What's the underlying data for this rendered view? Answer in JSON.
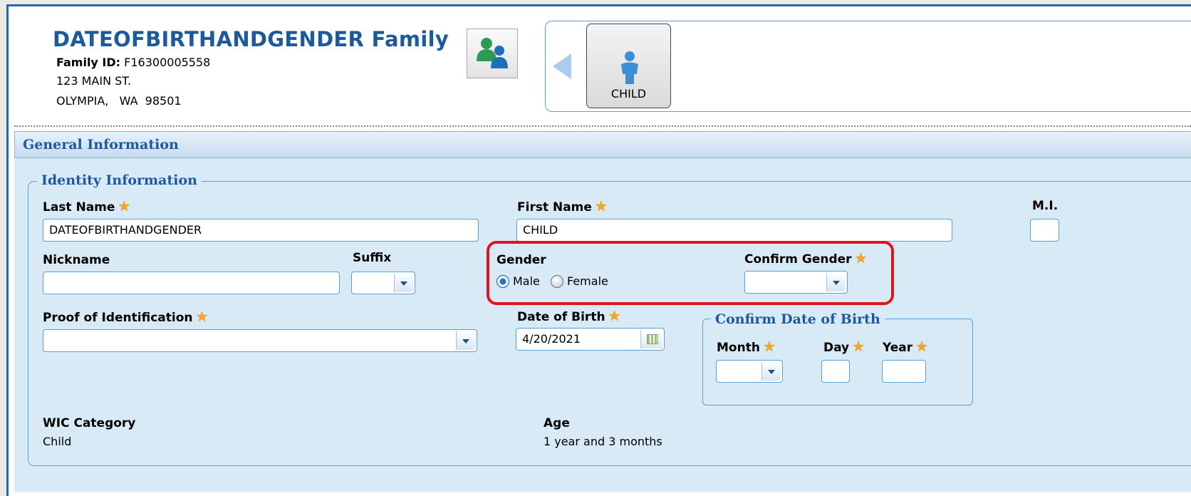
{
  "family": {
    "title": "DATEOFBIRTHANDGENDER Family",
    "id_label": "Family ID:",
    "id_value": "F16300005558",
    "address_line1": "123 MAIN ST.",
    "address_line2": "OLYMPIA,   WA  98501"
  },
  "members": [
    {
      "label": "CHILD",
      "icon": "child-person-icon",
      "selected": true
    }
  ],
  "section": {
    "title": "General Information"
  },
  "identity": {
    "legend": "Identity Information",
    "last_name": {
      "label": "Last Name",
      "value": "DATEOFBIRTHANDGENDER",
      "required": true
    },
    "first_name": {
      "label": "First Name",
      "value": "CHILD",
      "required": true
    },
    "mi": {
      "label": "M.I.",
      "value": ""
    },
    "nickname": {
      "label": "Nickname",
      "value": ""
    },
    "suffix": {
      "label": "Suffix",
      "value": ""
    },
    "gender": {
      "label": "Gender",
      "options": [
        "Male",
        "Female"
      ],
      "selected": "Male"
    },
    "confirm_gender": {
      "label": "Confirm Gender",
      "value": "",
      "required": true
    },
    "proof_of_id": {
      "label": "Proof of Identification",
      "value": "",
      "required": true
    },
    "dob": {
      "label": "Date of Birth",
      "value": "4/20/2021",
      "required": true
    },
    "confirm_dob": {
      "legend": "Confirm Date of Birth",
      "month_label": "Month",
      "day_label": "Day",
      "year_label": "Year"
    },
    "wic_category": {
      "label": "WIC Category",
      "value": "Child"
    },
    "age": {
      "label": "Age",
      "value": "1 year and 3 months"
    }
  },
  "colors": {
    "accent": "#1d5a9c",
    "panel": "#d8eaf6",
    "highlight": "#e0141c",
    "star": "#f5a623"
  }
}
